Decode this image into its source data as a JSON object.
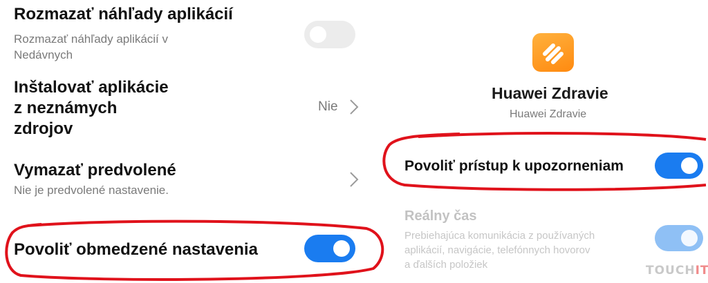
{
  "left": {
    "blur": {
      "title": "Rozmazať náhľady aplikácií",
      "subtitle_line1": "Rozmazať náhľady aplikácií v",
      "subtitle_line2": "Nedávnych",
      "toggle_on": false
    },
    "install": {
      "title_line1": "Inštalovať aplikácie",
      "title_line2": "z neznámych",
      "title_line3": "zdrojov",
      "value": "Nie"
    },
    "clear_defaults": {
      "title": "Vymazať predvolené",
      "subtitle": "Nie je predvolené nastavenie."
    },
    "restricted": {
      "title": "Povoliť obmedzené nastavenia",
      "toggle_on": true
    }
  },
  "right": {
    "app_name": "Huawei Zdravie",
    "app_package": "Huawei Zdravie",
    "notif_access": {
      "title": "Povoliť prístup k upozorneniam",
      "toggle_on": true
    },
    "realtime": {
      "title": "Reálny čas",
      "desc_line1": "Prebiehajúca komunikácia z používaných",
      "desc_line2": "aplikácií, navigácie, telefónnych hovorov",
      "desc_line3": "a ďalších položiek",
      "toggle_on": true,
      "disabled": true
    }
  },
  "watermark": {
    "part1": "TOUCH",
    "part2": "IT"
  },
  "colors": {
    "accent": "#1a7cf0",
    "highlight": "#e0121b",
    "icon_orange": "#ff8a10"
  }
}
